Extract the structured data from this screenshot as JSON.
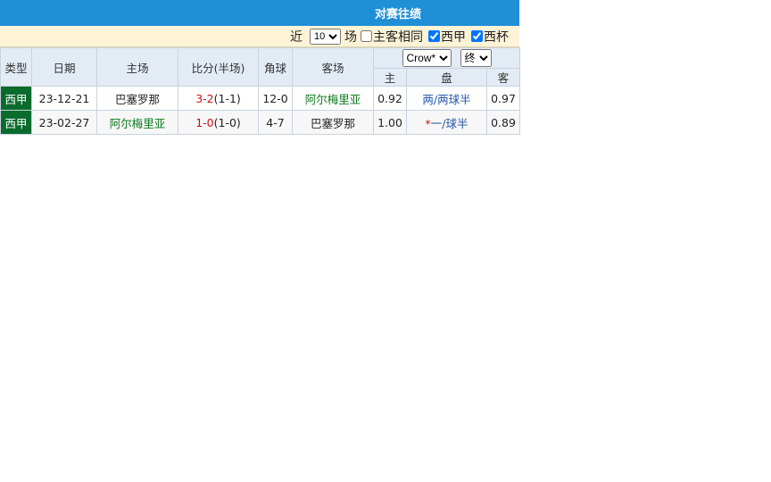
{
  "title": "对赛往绩",
  "filter": {
    "recent_label": "近",
    "recent_value": "10",
    "recent_options": [
      "10"
    ],
    "unit_label": "场",
    "same_home_label": "主客相同",
    "same_home_checked": false,
    "leagues": [
      {
        "label": "西甲",
        "checked": true
      },
      {
        "label": "西杯",
        "checked": true
      }
    ]
  },
  "table": {
    "headers": {
      "type": "类型",
      "date": "日期",
      "home": "主场",
      "score": "比分(半场)",
      "corner": "角球",
      "away": "客场",
      "odds_home": "主",
      "odds_line": "盘",
      "odds_away": "客"
    },
    "company_select": "Crow*",
    "stage_select": "终",
    "rows": [
      {
        "league": "西甲",
        "date": "23-12-21",
        "home": "巴塞罗那",
        "score": "3-2",
        "half": "(1-1)",
        "corner": "12-0",
        "away": "阿尔梅里亚",
        "odds_home": "0.92",
        "line_prefix": "",
        "line": "两/两球半",
        "odds_away": "0.97"
      },
      {
        "league": "西甲",
        "date": "23-02-27",
        "home": "阿尔梅里亚",
        "score": "1-0",
        "half": "(1-0)",
        "corner": "4-7",
        "away": "巴塞罗那",
        "odds_home": "1.00",
        "line_prefix": "*",
        "line": "一/球半",
        "odds_away": "0.89"
      }
    ]
  }
}
